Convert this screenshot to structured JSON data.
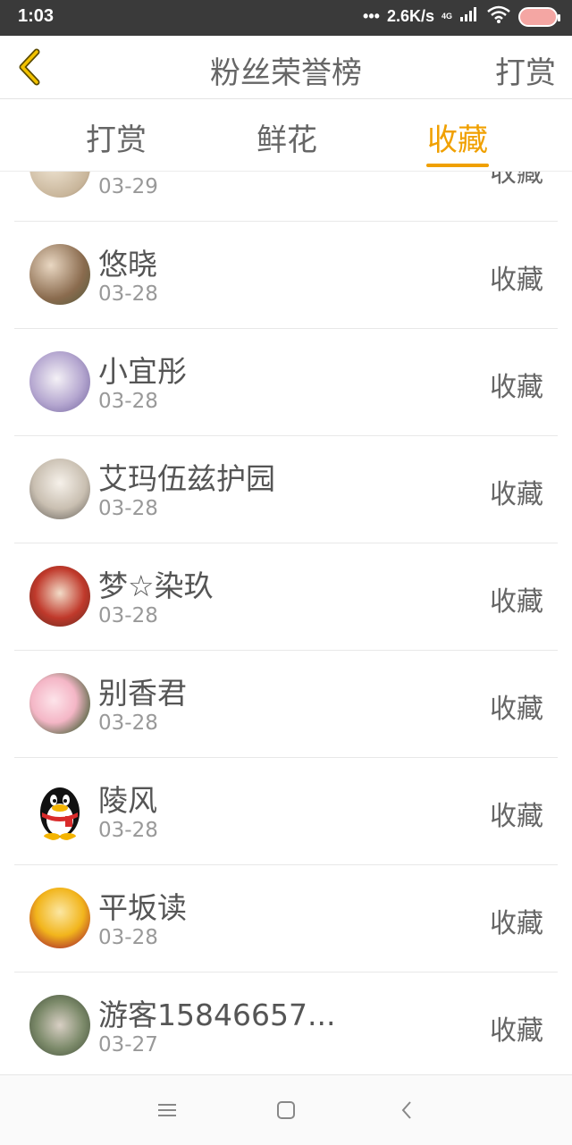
{
  "status_bar": {
    "time": "1:03",
    "network_speed": "2.6K/s",
    "network_type": "4G",
    "icons": [
      "signal-dots-icon",
      "signal-bars-icon",
      "wifi-icon",
      "battery-icon"
    ]
  },
  "header": {
    "title": "粉丝荣誉榜",
    "right_action": "打赏",
    "back_icon": "chevron-left-icon"
  },
  "tabs": [
    {
      "label": "打赏",
      "active": false
    },
    {
      "label": "鲜花",
      "active": false
    },
    {
      "label": "收藏",
      "active": true
    }
  ],
  "accent_color": "#f0a000",
  "rows": [
    {
      "name": "",
      "date": "03-29",
      "action": "收藏"
    },
    {
      "name": "悠晓",
      "date": "03-28",
      "action": "收藏"
    },
    {
      "name": "小宜彤",
      "date": "03-28",
      "action": "收藏"
    },
    {
      "name": "艾玛伍兹护园",
      "date": "03-28",
      "action": "收藏"
    },
    {
      "name": "梦☆染玖",
      "date": "03-28",
      "action": "收藏"
    },
    {
      "name": "别香君",
      "date": "03-28",
      "action": "收藏"
    },
    {
      "name": "陵风",
      "date": "03-28",
      "action": "收藏"
    },
    {
      "name": "平坂读",
      "date": "03-28",
      "action": "收藏"
    },
    {
      "name": "游客15846657...",
      "date": "03-27",
      "action": "收藏"
    }
  ],
  "nav_bar": {
    "icons": [
      "menu-icon",
      "home-icon",
      "back-icon"
    ]
  }
}
